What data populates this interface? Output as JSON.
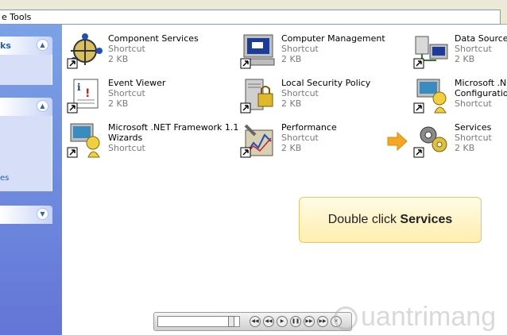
{
  "window": {
    "address_text": "e Tools"
  },
  "sidebar": {
    "panels": [
      {
        "header_fragment": "ks",
        "chevron": "up"
      },
      {
        "header_fragment": "",
        "chevron": "up",
        "body_fragment": "es"
      },
      {
        "header_fragment": "",
        "chevron": "down"
      }
    ]
  },
  "items": [
    {
      "name": "Component Services",
      "type": "Shortcut",
      "size": "2 KB",
      "icon": "component-services-icon"
    },
    {
      "name": "Computer Management",
      "type": "Shortcut",
      "size": "2 KB",
      "icon": "computer-management-icon"
    },
    {
      "name": "Data Sources",
      "type": "Shortcut",
      "size": "2 KB",
      "icon": "data-sources-icon"
    },
    {
      "name": "Event Viewer",
      "type": "Shortcut",
      "size": "2 KB",
      "icon": "event-viewer-icon"
    },
    {
      "name": "Local Security Policy",
      "type": "Shortcut",
      "size": "2 KB",
      "icon": "local-security-policy-icon"
    },
    {
      "name": "Microsoft .NET",
      "name2": "Configuration",
      "type": "Shortcut",
      "icon": "net-configuration-icon"
    },
    {
      "name": "Microsoft .NET Framework 1.1",
      "name2": "Wizards",
      "type": "Shortcut",
      "icon": "net-wizards-icon"
    },
    {
      "name": "Performance",
      "type": "Shortcut",
      "size": "2 KB",
      "icon": "performance-icon"
    },
    {
      "name": "Services",
      "type": "Shortcut",
      "size": "2 KB",
      "icon": "services-icon"
    }
  ],
  "callout": {
    "prefix": "Double click ",
    "bold": "Services"
  },
  "player": {
    "progress": 0.94
  },
  "watermark": {
    "text": "uantrimang"
  },
  "colors": {
    "sidebar": "#6f8de0",
    "callout_bg": "#fff4c4",
    "arrow": "#f5a623"
  }
}
